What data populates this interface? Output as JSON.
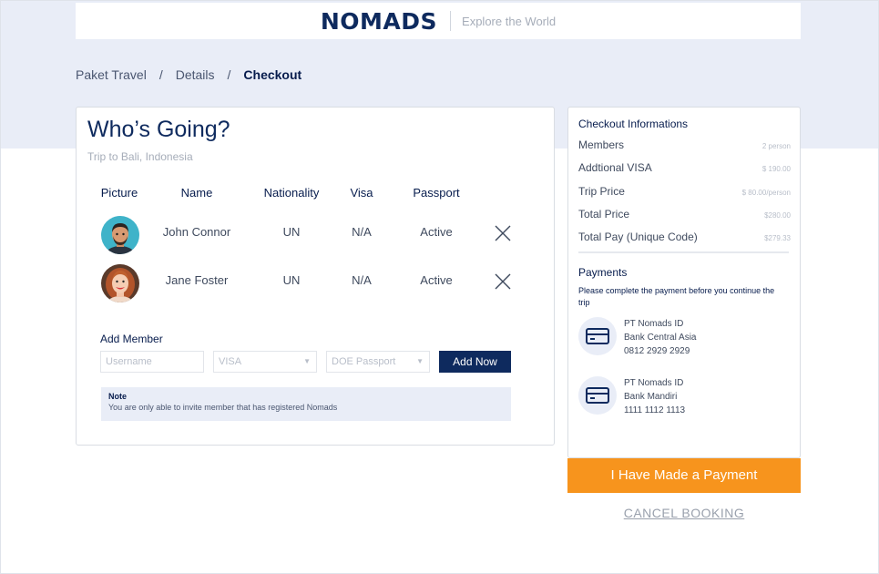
{
  "header": {
    "logo_text": "NOMADS",
    "tagline": "Explore the World"
  },
  "breadcrumb": {
    "items": [
      "Paket Travel",
      "Details",
      "Checkout"
    ],
    "separator": "/"
  },
  "main": {
    "title": "Who’s Going?",
    "subtitle": "Trip to Bali, Indonesia",
    "table": {
      "headers": [
        "Picture",
        "Name",
        "Nationality",
        "Visa",
        "Passport"
      ],
      "rows": [
        {
          "name": "John Connor",
          "nationality": "UN",
          "visa": "N/A",
          "passport": "Active"
        },
        {
          "name": "Jane Foster",
          "nationality": "UN",
          "visa": "N/A",
          "passport": "Active"
        }
      ]
    },
    "add_member": {
      "label": "Add Member",
      "username_placeholder": "Username",
      "visa_placeholder": "VISA",
      "doe_placeholder": "DOE Passport",
      "button": "Add Now"
    },
    "note": {
      "title": "Note",
      "text": "You are only able to invite member that has registered Nomads"
    }
  },
  "checkout": {
    "title": "Checkout Informations",
    "rows": [
      {
        "label": "Members",
        "value": "2 person"
      },
      {
        "label": "Addtional VISA",
        "value": "$ 190.00"
      },
      {
        "label": "Trip Price",
        "value": "$ 80.00/person"
      },
      {
        "label": "Total Price",
        "value": "$280.00"
      },
      {
        "label": "Total Pay (Unique Code)",
        "value": "$279.33"
      }
    ],
    "payments_title": "Payments",
    "payments_desc": "Please complete the payment before you continue the trip",
    "banks": [
      {
        "holder": "PT Nomads ID",
        "bank": "Bank Central Asia",
        "account": "0812 2929 2929"
      },
      {
        "holder": "PT Nomads ID",
        "bank": "Bank Mandiri",
        "account": "1111 1112 1113"
      }
    ]
  },
  "actions": {
    "pay_button": "I Have Made a Payment",
    "cancel_button": "CANCEL BOOKING"
  },
  "colors": {
    "navy": "#0e2a5e",
    "accent_orange": "#f7941d",
    "hero_bg": "#e9edf7"
  },
  "icons": [
    "close-icon",
    "credit-card-icon",
    "chevron-down-icon"
  ]
}
